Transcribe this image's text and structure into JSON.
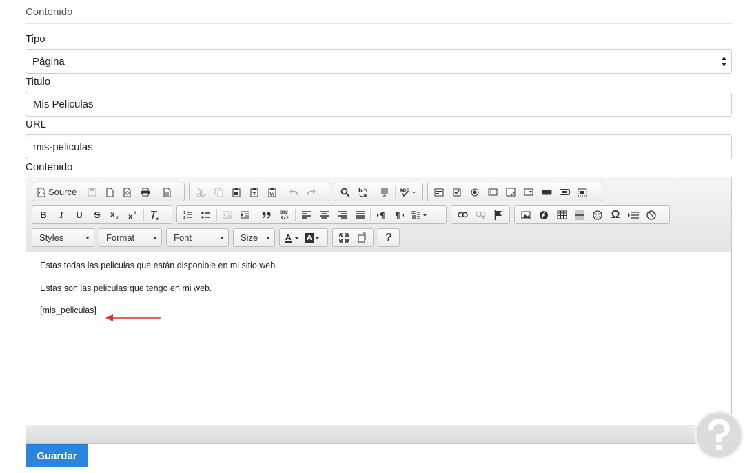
{
  "section": {
    "title": "Contenido"
  },
  "form": {
    "tipo_label": "Tipo",
    "tipo_value": "Página",
    "titulo_label": "Titulo",
    "titulo_value": "Mis Peliculas",
    "url_label": "URL",
    "url_value": "mis-peliculas",
    "contenido_label": "Contenido"
  },
  "toolbar": {
    "source_label": "Source",
    "styles_label": "Styles",
    "format_label": "Format",
    "font_label": "Font",
    "size_label": "Size",
    "bold": "B",
    "italic": "I",
    "underline": "U",
    "strike": "S",
    "help": "?",
    "special_char": "Ω"
  },
  "editor": {
    "lines": [
      "Estas todas las peliculas que están disponible en mi sitio web.",
      "Estas son las peliculas que tengo en mi web.",
      "[mis_peliculas]"
    ]
  },
  "actions": {
    "save_label": "Guardar"
  },
  "colors": {
    "accent": "#2a84e0",
    "arrow": "#e0302c",
    "watermark": "#d9d9d9"
  },
  "icons": [
    "source-icon",
    "save-icon",
    "new-page-icon",
    "preview-icon",
    "print-icon",
    "templates-icon",
    "cut-icon",
    "copy-icon",
    "paste-icon",
    "paste-text-icon",
    "paste-word-icon",
    "undo-icon",
    "redo-icon",
    "find-icon",
    "replace-icon",
    "select-all-icon",
    "spellcheck-icon",
    "form-icon",
    "checkbox-icon",
    "radio-icon",
    "text-field-icon",
    "textarea-icon",
    "select-icon",
    "button-icon",
    "image-button-icon",
    "hidden-field-icon",
    "subscript-icon",
    "superscript-icon",
    "remove-format-icon",
    "numbered-list-icon",
    "bulleted-list-icon",
    "outdent-icon",
    "indent-icon",
    "blockquote-icon",
    "div-icon",
    "align-left-icon",
    "align-center-icon",
    "align-right-icon",
    "justify-icon",
    "ltr-icon",
    "rtl-icon",
    "language-icon",
    "link-icon",
    "unlink-icon",
    "anchor-icon",
    "image-icon",
    "flash-icon",
    "table-icon",
    "horizontal-rule-icon",
    "smiley-icon",
    "page-break-icon",
    "iframe-icon",
    "text-color-icon",
    "background-color-icon",
    "maximize-icon",
    "show-blocks-icon",
    "help-icon"
  ]
}
